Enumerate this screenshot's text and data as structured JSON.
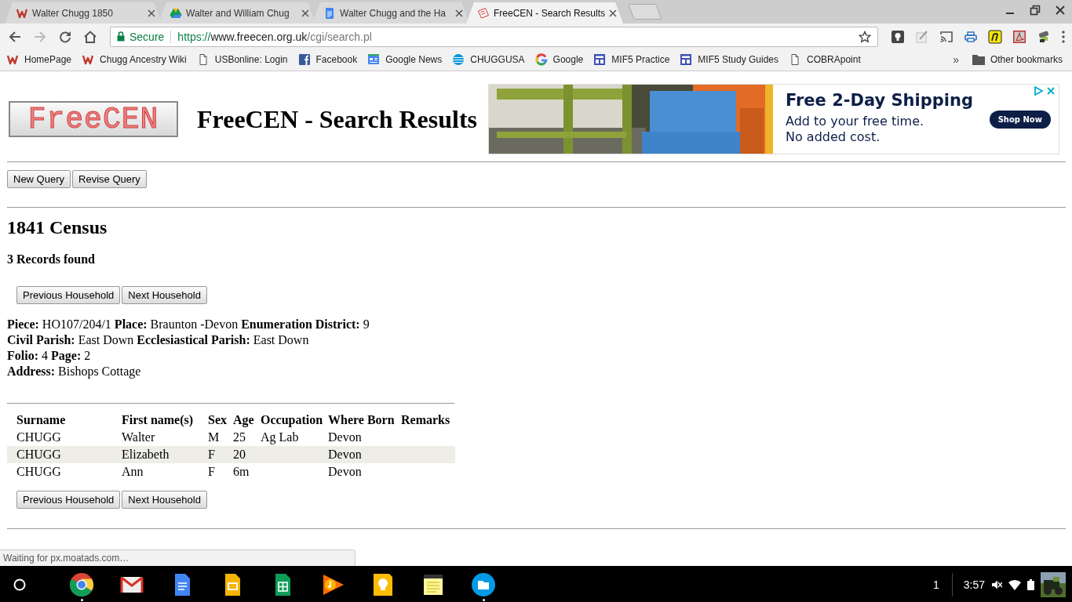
{
  "window": {
    "tabs": [
      {
        "title": "Walter Chugg 1850",
        "kind": "wiki",
        "selected": false
      },
      {
        "title": "Walter and William Chug",
        "kind": "drive",
        "selected": false
      },
      {
        "title": "Walter Chugg and the Ha",
        "kind": "docs",
        "selected": false
      },
      {
        "title": "FreeCEN - Search Results",
        "kind": "paper",
        "selected": true
      }
    ]
  },
  "toolbar": {
    "secure_label": "Secure",
    "url": {
      "scheme": "https://",
      "host": "www.freecen.org.uk",
      "path": "/cgi/search.pl"
    }
  },
  "bookmarks": [
    {
      "label": "HomePage",
      "kind": "wiki"
    },
    {
      "label": "Chugg Ancestry Wiki",
      "kind": "wiki"
    },
    {
      "label": "USBonline: Login",
      "kind": "page"
    },
    {
      "label": "Facebook",
      "kind": "facebook"
    },
    {
      "label": "Google News",
      "kind": "news"
    },
    {
      "label": "CHUGGUSA",
      "kind": "globe"
    },
    {
      "label": "Google",
      "kind": "google"
    },
    {
      "label": "MIF5 Practice",
      "kind": "board"
    },
    {
      "label": "MIF5 Study Guides",
      "kind": "board"
    },
    {
      "label": "COBRApoint",
      "kind": "page"
    }
  ],
  "bookmarks_overflow": "»",
  "other_bookmarks": "Other bookmarks",
  "page": {
    "logo": "FreeCEN",
    "title": "FreeCEN - Search Results",
    "ad": {
      "kind": "picture",
      "headline": "Free 2-Day Shipping",
      "lines": [
        "Add to your free time.",
        "No added cost."
      ],
      "button": "Shop Now"
    },
    "query_buttons": [
      "New Query",
      "Revise Query"
    ],
    "heading": "1841 Census",
    "records": "3 Records found",
    "household_nav_top": [
      "Previous Household",
      "Next Household"
    ],
    "details": [
      "**Piece:** HO107/204/1 **Place:** Braunton -Devon **Enumeration District:** 9",
      "**Civil Parish:** East Down **Ecclesiastical Parish:** East Down",
      "**Folio:** 4 **Page:** 2",
      "**Address:** Bishops Cottage"
    ],
    "table": {
      "columns": [
        "Surname",
        "First name(s)",
        "Sex",
        "Age",
        "Occupation",
        "Where Born",
        "Remarks"
      ],
      "rows": [
        {
          "surname": "CHUGG",
          "first_names": "Walter",
          "sex": "M",
          "age": "25",
          "occupation": "Ag Lab",
          "where_born": "Devon"
        },
        {
          "surname": "CHUGG",
          "first_names": "Elizabeth",
          "sex": "F",
          "age": "20",
          "where_born": "Devon"
        },
        {
          "surname": "CHUGG",
          "first_names": "Ann",
          "sex": "F",
          "age": "6m",
          "where_born": "Devon"
        }
      ]
    },
    "household_nav_bottom": [
      "Previous Household",
      "Next Household"
    ]
  },
  "status_bubble": "Waiting for px.moatads.com…",
  "shelf": {
    "apps": [
      {
        "kind": "chrome",
        "running": true
      },
      {
        "kind": "gmail",
        "running": false
      },
      {
        "kind": "docs",
        "running": false
      },
      {
        "kind": "slides",
        "running": false
      },
      {
        "kind": "sheets",
        "running": false
      },
      {
        "kind": "music",
        "running": false
      },
      {
        "kind": "keep",
        "running": false
      },
      {
        "kind": "notes",
        "running": false
      },
      {
        "kind": "files",
        "running": true
      }
    ],
    "notification_count": "1",
    "time": "3:57"
  }
}
